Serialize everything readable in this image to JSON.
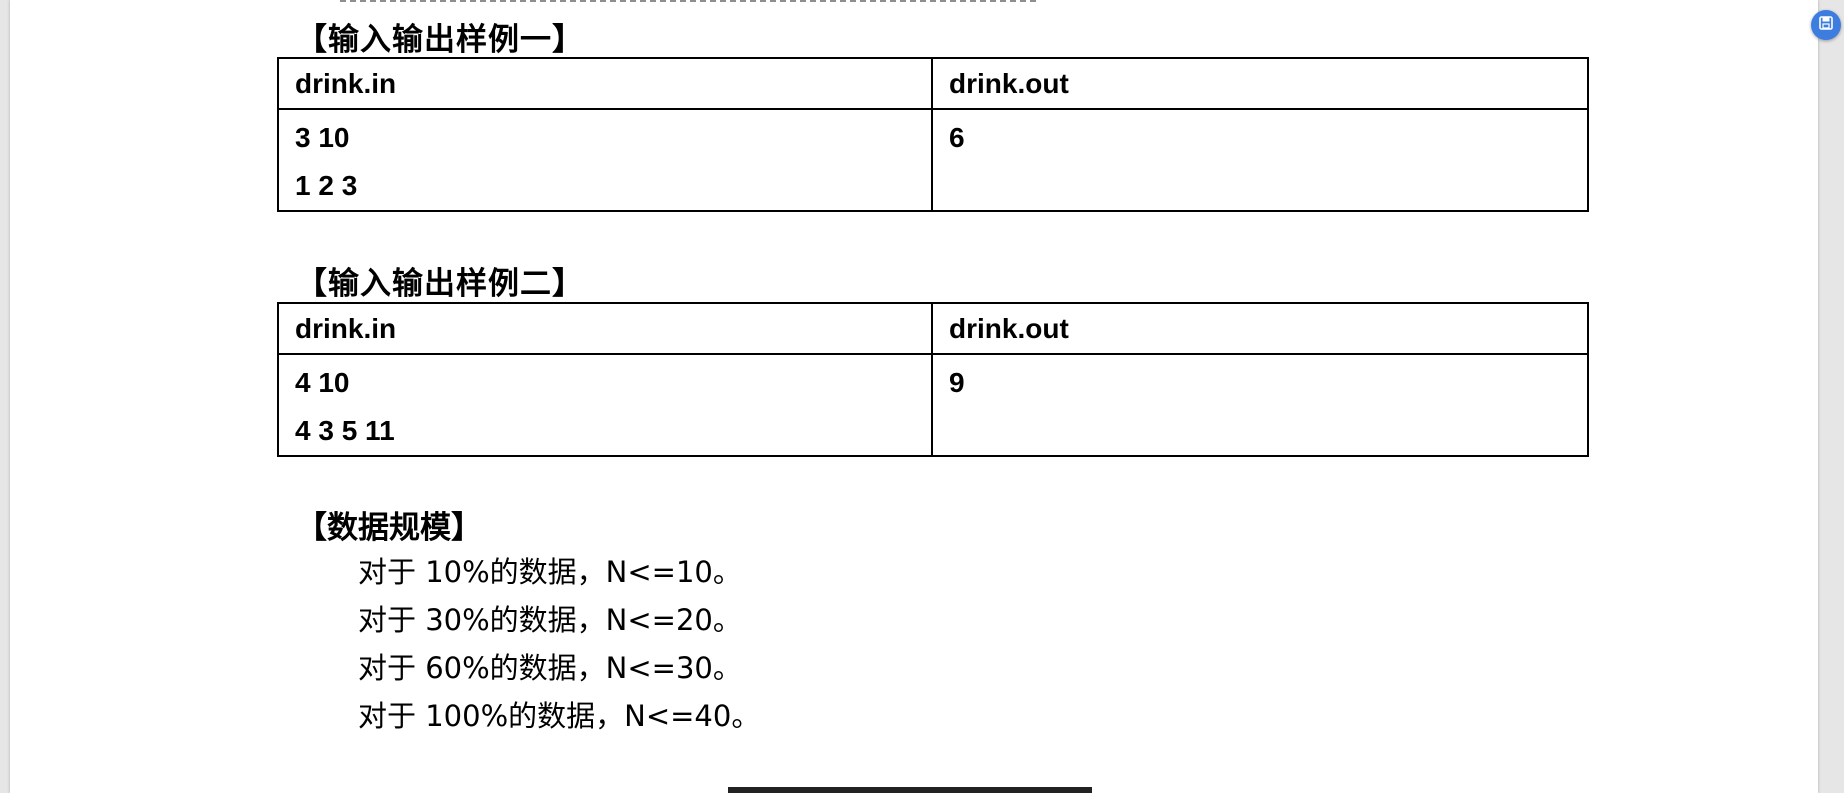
{
  "sample1": {
    "heading": "【输入输出样例一】",
    "headers": [
      "drink.in",
      "drink.out"
    ],
    "input_lines": [
      "3 10",
      "1 2 3"
    ],
    "output_lines": [
      "6"
    ]
  },
  "sample2": {
    "heading": "【输入输出样例二】",
    "headers": [
      "drink.in",
      "drink.out"
    ],
    "input_lines": [
      "4 10",
      "4 3 5 11"
    ],
    "output_lines": [
      "9"
    ]
  },
  "data_scale": {
    "heading": "【数据规模】",
    "items": [
      "对于 10%的数据，N<=10。",
      "对于 30%的数据，N<=20。",
      "对于 60%的数据，N<=30。",
      "对于 100%的数据，N<=40。"
    ]
  },
  "viewer": {
    "corner_button_icon": "save-icon",
    "accent_color": "#3d7de0"
  }
}
